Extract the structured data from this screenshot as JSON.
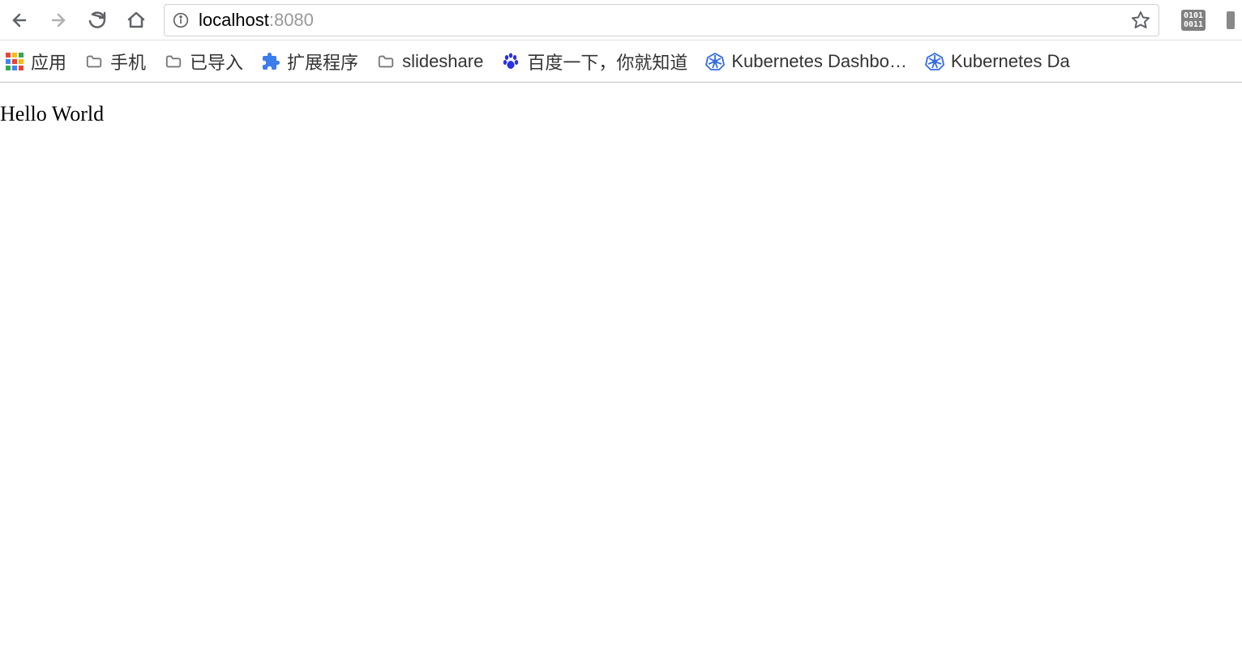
{
  "toolbar": {
    "url_host": "localhost",
    "url_port": ":8080",
    "extension_badge_line1": "0101",
    "extension_badge_line2": "0011"
  },
  "bookmarks": {
    "items": [
      {
        "label": "应用",
        "icon": "apps"
      },
      {
        "label": "手机",
        "icon": "folder"
      },
      {
        "label": "已导入",
        "icon": "folder"
      },
      {
        "label": "扩展程序",
        "icon": "puzzle"
      },
      {
        "label": "slideshare",
        "icon": "folder"
      },
      {
        "label": "百度一下，你就知道",
        "icon": "baidu"
      },
      {
        "label": "Kubernetes Dashbo…",
        "icon": "k8s"
      },
      {
        "label": "Kubernetes Da",
        "icon": "k8s"
      }
    ]
  },
  "page": {
    "body_text": "Hello World"
  }
}
